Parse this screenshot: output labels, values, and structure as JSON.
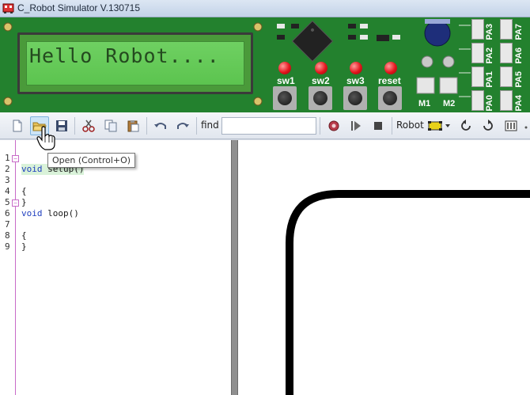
{
  "window": {
    "title": "C_Robot Simulator V.130715"
  },
  "board": {
    "lcd_text": "Hello Robot....",
    "buttons": [
      "sw1",
      "sw2",
      "sw3",
      "reset"
    ],
    "motor_labels": [
      "M1",
      "M2"
    ],
    "ports_left": [
      "PA3",
      "PA2",
      "PA1",
      "PA0"
    ],
    "ports_right": [
      "PA7",
      "PA6",
      "PA5",
      "PA4"
    ]
  },
  "toolbar": {
    "find_label": "find",
    "find_value": "",
    "robot_label": "Robot"
  },
  "tooltip": {
    "text": "Open (Control+O)"
  },
  "editor": {
    "lines": [
      {
        "num": "1",
        "text": "void setup()"
      },
      {
        "num": "2",
        "text": "{"
      },
      {
        "num": "3",
        "text": ""
      },
      {
        "num": "4",
        "text": "}"
      },
      {
        "num": "5",
        "text": "void loop()"
      },
      {
        "num": "6",
        "text": "{"
      },
      {
        "num": "7",
        "text": ""
      },
      {
        "num": "8",
        "text": "}"
      },
      {
        "num": "9",
        "text": ""
      }
    ]
  },
  "colors": {
    "board_green": "#1f7a2b",
    "lcd_green": "#5cc44f",
    "fold_magenta": "#c86bc8",
    "keyword_blue": "#1f3fbf"
  }
}
